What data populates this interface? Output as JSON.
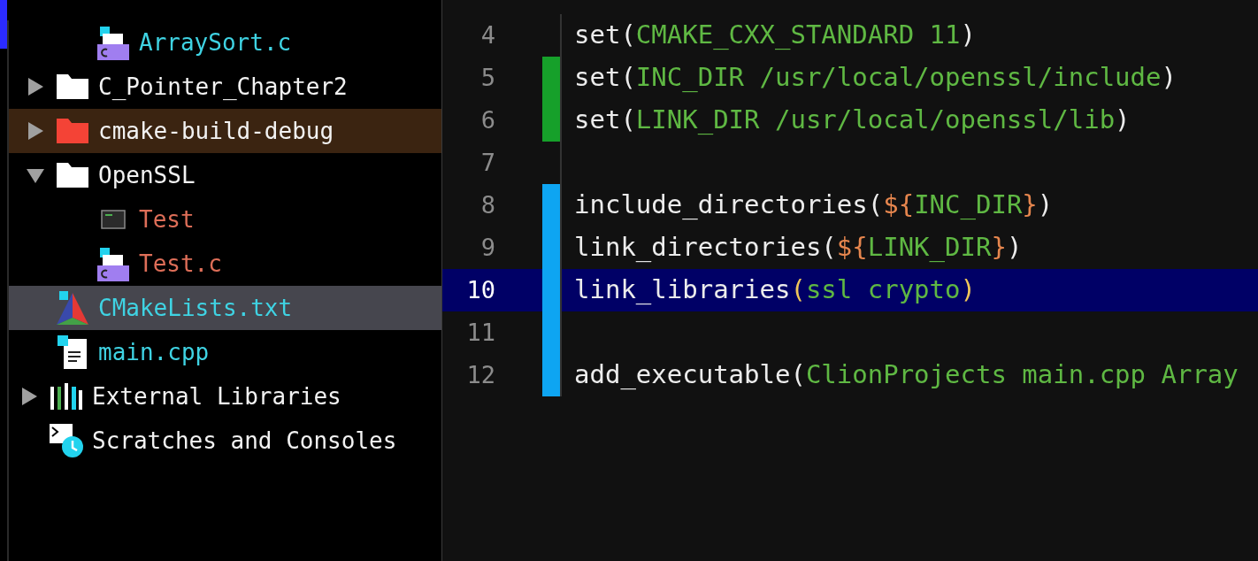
{
  "project_tree": [
    {
      "children": [
        {
          "children": [
            {
              "label": "ArraySort.c",
              "kind": "c-file",
              "color": "#3fd3e3",
              "selected": false,
              "excluded": false
            }
          ]
        },
        {
          "label": "C_Pointer_Chapter2",
          "kind": "folder",
          "color": "#f2f2f2",
          "selected": false,
          "excluded": false,
          "expanded": false
        },
        {
          "label": "cmake-build-debug",
          "kind": "folder",
          "color": "#f2f2f2",
          "selected": false,
          "excluded": true,
          "expanded": false
        },
        {
          "label": "OpenSSL",
          "kind": "folder",
          "color": "#f2f2f2",
          "selected": false,
          "excluded": false,
          "expanded": true,
          "children": [
            {
              "label": "Test",
              "kind": "executable",
              "color": "#de6e58",
              "selected": false,
              "excluded": false
            },
            {
              "label": "Test.c",
              "kind": "c-file",
              "color": "#de6e58",
              "selected": false,
              "excluded": false
            }
          ]
        },
        {
          "label": "CMakeLists.txt",
          "kind": "cmake",
          "color": "#3fd3e3",
          "selected": true,
          "excluded": false
        },
        {
          "label": "main.cpp",
          "kind": "cpp-file",
          "color": "#3fd3e3",
          "selected": false,
          "excluded": false
        }
      ]
    },
    {
      "label": "External Libraries",
      "kind": "libraries",
      "color": "#f2f2f2",
      "selected": false,
      "excluded": false,
      "expanded": false
    },
    {
      "label": "Scratches and Consoles",
      "kind": "scratches",
      "color": "#f2f2f2",
      "selected": false,
      "excluded": false
    }
  ],
  "editor": {
    "lines": [
      {
        "number": "4",
        "current": false,
        "kind": "unchanged",
        "tokens": [
          {
            "kind": "plain",
            "text": "set("
          },
          {
            "kind": "arg",
            "text": "CMAKE_CXX_STANDARD 11"
          },
          {
            "kind": "plain",
            "text": ")"
          }
        ]
      },
      {
        "number": "5",
        "current": false,
        "kind": "added",
        "tokens": [
          {
            "kind": "plain",
            "text": "set("
          },
          {
            "kind": "arg",
            "text": "INC_DIR /usr/local/openssl/include"
          },
          {
            "kind": "plain",
            "text": ")"
          }
        ]
      },
      {
        "number": "6",
        "current": false,
        "kind": "added",
        "tokens": [
          {
            "kind": "plain",
            "text": "set("
          },
          {
            "kind": "arg",
            "text": "LINK_DIR /usr/local/openssl/lib"
          },
          {
            "kind": "plain",
            "text": ")"
          }
        ]
      },
      {
        "number": "7",
        "current": false,
        "kind": "unchanged"
      },
      {
        "number": "8",
        "current": false,
        "kind": "modified",
        "tokens": [
          {
            "kind": "plain",
            "text": "include_directories("
          },
          {
            "kind": "brace",
            "text": "${"
          },
          {
            "kind": "arg",
            "text": "INC_DIR"
          },
          {
            "kind": "brace",
            "text": "}"
          },
          {
            "kind": "plain",
            "text": ")"
          }
        ]
      },
      {
        "number": "9",
        "current": false,
        "kind": "modified",
        "tokens": [
          {
            "kind": "plain",
            "text": "link_directories("
          },
          {
            "kind": "brace",
            "text": "${"
          },
          {
            "kind": "arg",
            "text": "LINK_DIR"
          },
          {
            "kind": "brace",
            "text": "}"
          },
          {
            "kind": "plain",
            "text": ")"
          }
        ]
      },
      {
        "number": "10",
        "current": true,
        "kind": "modified",
        "tokens": [
          {
            "kind": "plain",
            "text": "link_libraries"
          },
          {
            "kind": "matched-paren",
            "text": "("
          },
          {
            "kind": "arg",
            "text": "ssl crypto"
          },
          {
            "kind": "matched-paren",
            "text": ")"
          }
        ]
      },
      {
        "number": "11",
        "current": false,
        "kind": "modified"
      },
      {
        "number": "12",
        "current": false,
        "kind": "modified",
        "tokens": [
          {
            "kind": "plain",
            "text": "add_executable("
          },
          {
            "kind": "arg",
            "text": "ClionProjects main.cpp Array"
          }
        ]
      }
    ]
  }
}
